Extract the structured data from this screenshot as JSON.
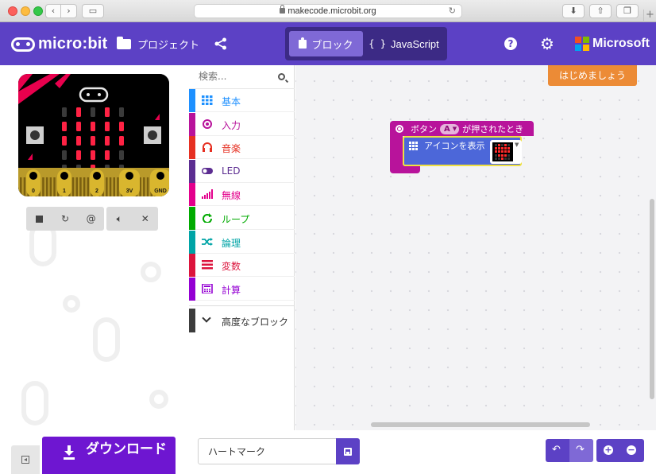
{
  "browser": {
    "url": "makecode.microbit.org",
    "icons": [
      "back-icon",
      "forward-icon",
      "sidebar-icon",
      "lock-icon",
      "reload-icon",
      "download-icon",
      "share-icon",
      "tabs-icon",
      "new-tab-icon"
    ]
  },
  "header": {
    "logo_text": "micro:bit",
    "projects_label": "プロジェクト",
    "toggle": {
      "blocks_label": "ブロック",
      "js_label": "JavaScript",
      "selected": "blocks"
    },
    "brand": "Microsoft",
    "colors": {
      "header_bg": "#5c41c5",
      "toggle_bg": "#3c2a85",
      "toggle_active": "#7f69d6"
    },
    "ms_colors": [
      "#f25022",
      "#7fba00",
      "#00a4ef",
      "#ffb900"
    ]
  },
  "simulator": {
    "pins": [
      "0",
      "1",
      "2",
      "3V",
      "GND"
    ],
    "led_matrix": [
      [
        0,
        1,
        0,
        1,
        0
      ],
      [
        1,
        1,
        1,
        1,
        1
      ],
      [
        1,
        1,
        1,
        1,
        1
      ],
      [
        0,
        1,
        1,
        1,
        0
      ],
      [
        0,
        0,
        1,
        0,
        0
      ]
    ],
    "controls": [
      "stop-icon",
      "restart-icon",
      "slowmo-icon",
      "mute-icon",
      "fullscreen-icon"
    ]
  },
  "toolbox": {
    "search_placeholder": "検索...",
    "categories": [
      {
        "label": "基本",
        "color": "#1e90ff",
        "icon": "grid-icon"
      },
      {
        "label": "入力",
        "color": "#b8139b",
        "icon": "target-icon"
      },
      {
        "label": "音楽",
        "color": "#e63022",
        "icon": "headphones-icon"
      },
      {
        "label": "LED",
        "color": "#5c2d91",
        "icon": "toggle-icon"
      },
      {
        "label": "無線",
        "color": "#e3008c",
        "icon": "signal-icon"
      },
      {
        "label": "ループ",
        "color": "#00aa00",
        "icon": "refresh-icon"
      },
      {
        "label": "論理",
        "color": "#00a4a6",
        "icon": "shuffle-icon"
      },
      {
        "label": "変数",
        "color": "#dc143c",
        "icon": "bars-icon"
      },
      {
        "label": "計算",
        "color": "#9400d3",
        "icon": "calculator-icon"
      }
    ],
    "advanced_label": "高度なブロック"
  },
  "workspace": {
    "tutorial_label": "はじめましょう",
    "event_block": {
      "prefix": "ボタン",
      "button_value": "A",
      "suffix": "が押されたとき",
      "color": "#b8139b"
    },
    "show_icon_block": {
      "label": "アイコンを表示",
      "color": "#4c67d9",
      "icon": "heart"
    }
  },
  "footer": {
    "download_label": "ダウンロード",
    "project_name": "ハートマーク",
    "icons": [
      "collapse-icon",
      "save-icon",
      "undo-icon",
      "redo-icon",
      "zoom-in-icon",
      "zoom-out-icon"
    ]
  }
}
